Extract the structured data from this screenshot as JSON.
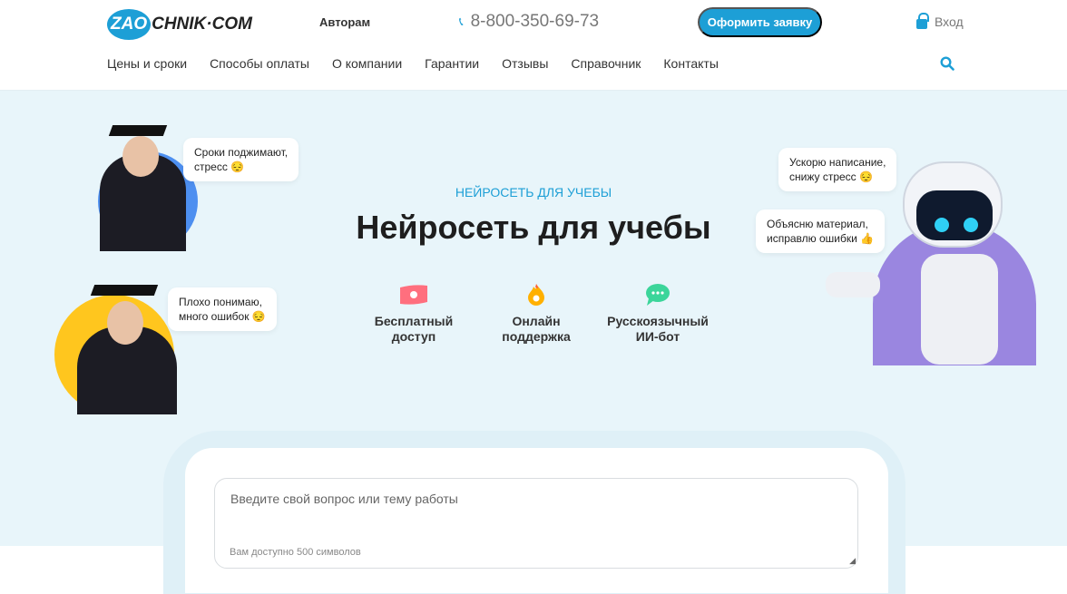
{
  "header": {
    "logo_left": "ZAO",
    "logo_right": "CHNIK·COM",
    "authors": "Авторам",
    "phone": "8-800-350-69-73",
    "order_button": "Оформить заявку",
    "login": "Вход",
    "nav": [
      "Цены и сроки",
      "Способы оплаты",
      "О компании",
      "Гарантии",
      "Отзывы",
      "Справочник",
      "Контакты"
    ]
  },
  "hero": {
    "eyebrow": "НЕЙРОСЕТЬ ДЛЯ УЧЕБЫ",
    "title": "Нейросеть для учебы",
    "features": [
      {
        "icon": "money-icon",
        "label1": "Бесплатный",
        "label2": "доступ"
      },
      {
        "icon": "flame-icon",
        "label1": "Онлайн",
        "label2": "поддержка"
      },
      {
        "icon": "chat-icon",
        "label1": "Русскоязычный",
        "label2": "ИИ-бот"
      }
    ],
    "bubbles": {
      "b1a": "Сроки поджимают,",
      "b1b": "стресс 😔",
      "b2a": "Плохо понимаю,",
      "b2b": "много ошибок 😔",
      "b3a": "Ускорю написание,",
      "b3b": "снижу стресс 😔",
      "b4a": "Объясню материал,",
      "b4b": "исправлю ошибки 👍"
    }
  },
  "chat": {
    "placeholder": "Введите свой вопрос или тему работы",
    "counter": "Вам доступно 500 символов"
  },
  "colors": {
    "accent": "#1d9fd6",
    "hero_bg": "#e8f5fa"
  }
}
